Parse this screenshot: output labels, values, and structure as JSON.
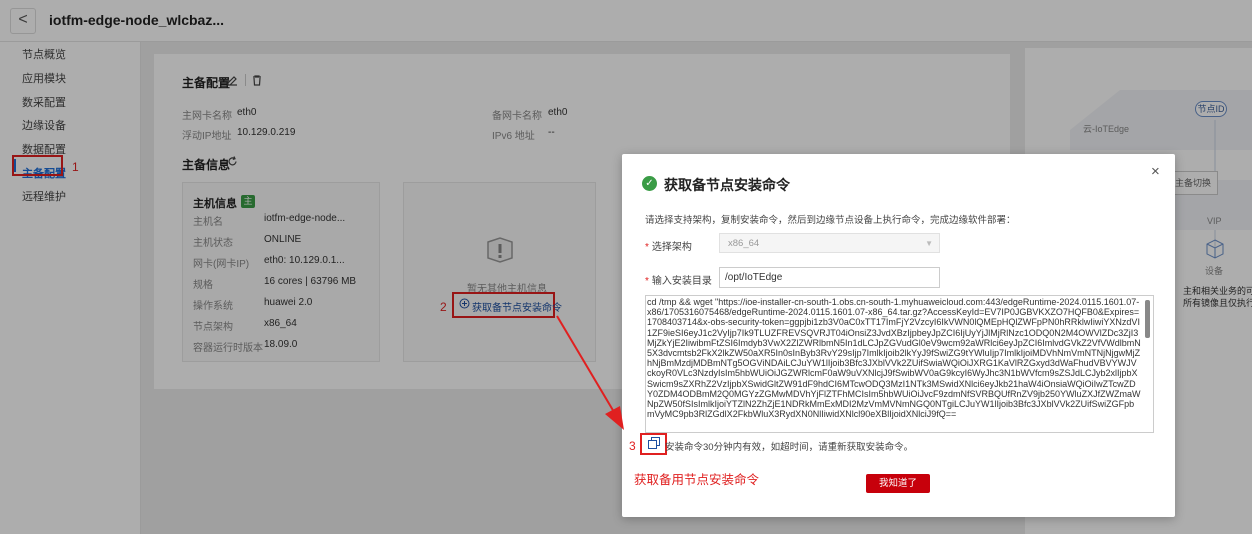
{
  "header": {
    "back_label": "<",
    "title": "iotfm-edge-node_wlcbaz..."
  },
  "sidebar": {
    "items": [
      {
        "label": "节点概览"
      },
      {
        "label": "应用模块"
      },
      {
        "label": "数采配置"
      },
      {
        "label": "边缘设备"
      },
      {
        "label": "数据配置"
      },
      {
        "label": "主备配置"
      },
      {
        "label": "远程维护"
      }
    ],
    "active_index": 5
  },
  "card": {
    "section1_title": "主备配置",
    "main_nic_label": "主网卡名称",
    "main_nic_value": "eth0",
    "backup_nic_label": "备网卡名称",
    "backup_nic_value": "eth0",
    "float_ip_label": "浮动IP地址",
    "float_ip_value": "10.129.0.219",
    "ipv6_label": "IPv6 地址",
    "ipv6_value": "--",
    "section2_title": "主备信息",
    "host": {
      "title": "主机信息",
      "badge": "主",
      "rows": [
        {
          "k": "主机名",
          "v": "iotfm-edge-node..."
        },
        {
          "k": "主机状态",
          "v": "ONLINE"
        },
        {
          "k": "网卡(网卡IP)",
          "v": "eth0: 10.129.0.1..."
        },
        {
          "k": "规格",
          "v": "16 cores | 63796 MB"
        },
        {
          "k": "操作系统",
          "v": "huawei 2.0"
        },
        {
          "k": "节点架构",
          "v": "x86_64"
        },
        {
          "k": "容器运行时版本",
          "v": "18.09.0"
        }
      ]
    },
    "empty_text": "暂无其他主机信息",
    "get_cmd_label": "获取备节点安装命令"
  },
  "right_panel": {
    "node_id": "节点ID",
    "cloud_label": "云-IoTEdge",
    "switch_label": "主备切换",
    "vip_label": "VIP",
    "device_label": "设备",
    "cut_text_1": "主和相关业务的可持续",
    "cut_text_2": "所有镜像且仅执行age"
  },
  "modal": {
    "title": "获取备节点安装命令",
    "desc": "请选择支持架构，复制安装命令，然后到边缘节点设备上执行命令，完成边缘软件部署：",
    "arch_label": "选择架构",
    "arch_value": "x86_64",
    "dir_label": "输入安装目录",
    "dir_value": "/opt/IoTEdge",
    "command": "cd /tmp && wget \"https://ioe-installer-cn-south-1.obs.cn-south-1.myhuaweicloud.com:443/edgeRuntime-2024.0115.1601.07-x86/1705316075468/edgeRuntime-2024.0115.1601.07-x86_64.tar.gz?AccessKeyId=EV7IP0JGBVKXZO7HQFB0&Expires=1708403714&x-obs-security-token=ggpjbi1zb3V0aC0xTT17ImFjY2VzcyI6IkVWN0lQMEpHQlZWFpPN0hRRklwIiwiYXNzdVI1ZF9ieSI6eyJ1c2VyIjp7Ik9TLUZFREVSQVRJT04iOnsiZ3JvdXBzIjpbeyJpZCI6IjUyYjJlMjRlNzc1ODQ0N2M4OWVlZDc3ZjI3MjZkYjE2IiwibmFtZSI6Imdyb3VwX2ZlZWRlbmN5In1dLCJpZGVudGl0eV9wcm92aWRlci6eyJpZCI6ImlvdGVkZ2VfVWdlbmN5X3dvcmtsb2FkX2lkZW50aXR5In0sInByb3RvY29sIjp7ImlkIjoib2lkYyJ9fSwiZG9tYWluIjp7ImlkIjoiMDVhNmVmNTNjNjgwMjZhNjBmMzdjMDBmNTg5OGViNDAiLCJuYW1lIjoib3Bfc3JXblVVk2ZUifSwiaWQiOiJXRG1KaVlRZGxyd3dWaFhudVBVYWJVckoyR0VLc3NzdyIsIm5hbWUiOiJGZWRlcmF0aW9uVXNlcjJ9fSwibWV0aG9kcyI6WyJhc3N1bWVfcm9sZSJdLCJyb2xlIjpbXSwicm9sZXRhZ2VzIjpbXSwidGltZW91dF9hdCI6MTcwODQ3MzI1NTk3MSwidXNlci6eyJkb21haW4iOnsiaWQiOiIwZTcwZDY0ZDM4ODBmM2Q0MGYzZGMwMDVhYjFlZTFhMCIsIm5hbWUiOiJvcF9zdmNfSVRBQUfRnZV9jb250YWluZXJfZWZmaWNpZW50fSIsImlkIjoiYTZlN2ZhZjE1NDRkMmExMDI2MzVmMVNmNGQ0NTgiLCJuYW1lIjoib3Bfc3JXblVVk2ZUifSwiZGFpbmVyMC9pb3RlZGdlX2FkbWluX3RydXN0NlIiwidXNlcl90eXBlIjoidXNlciJ9fQ==",
    "note": "安装命令30分钟内有效，如超时间，请重新获取安装命令。",
    "ok_label": "我知道了",
    "close_label": "×"
  },
  "annotations": {
    "step1": "1",
    "step2": "2",
    "step3": "3",
    "caption": "获取备用节点安装命令"
  }
}
